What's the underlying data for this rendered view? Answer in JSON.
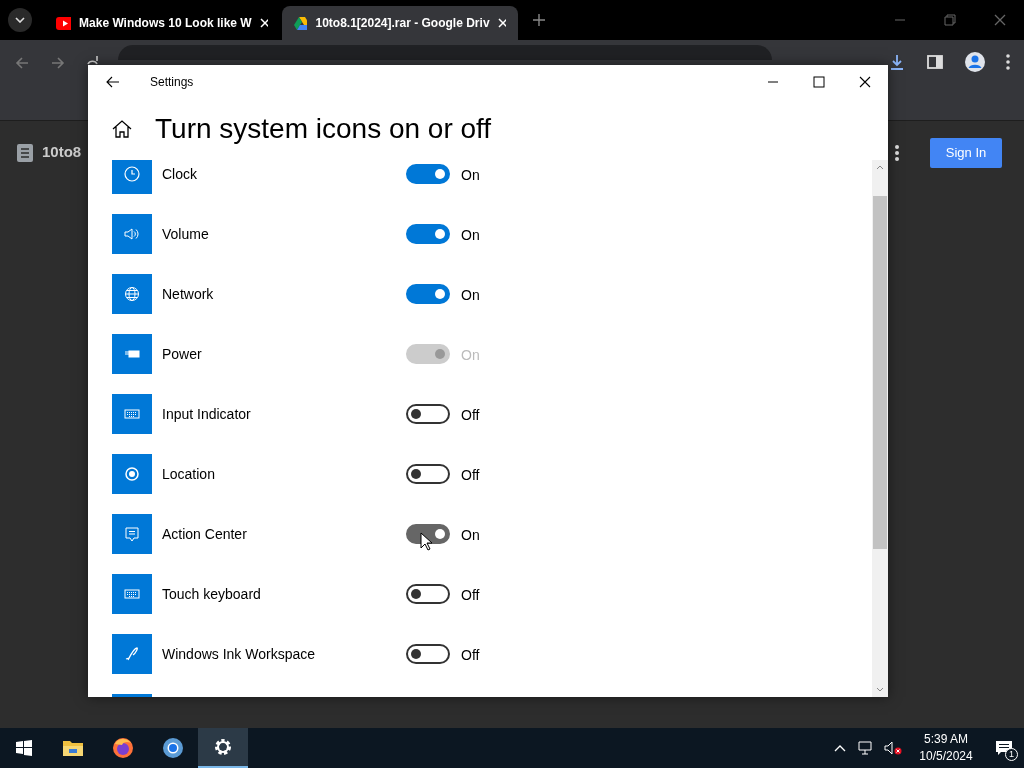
{
  "browser": {
    "tabs": [
      {
        "title": "Make Windows 10 Look like W",
        "selected": false
      },
      {
        "title": "10to8.1[2024].rar - Google Driv",
        "selected": true
      }
    ],
    "file_name": "10to8",
    "sign_in": "Sign In"
  },
  "window": {
    "title": "Settings"
  },
  "page_title": "Turn system icons on or off",
  "items": [
    {
      "label": "Clock",
      "on": true,
      "disabled": false,
      "hovered": false,
      "state_text": "On"
    },
    {
      "label": "Volume",
      "on": true,
      "disabled": false,
      "hovered": false,
      "state_text": "On"
    },
    {
      "label": "Network",
      "on": true,
      "disabled": false,
      "hovered": false,
      "state_text": "On"
    },
    {
      "label": "Power",
      "on": true,
      "disabled": true,
      "hovered": false,
      "state_text": "On"
    },
    {
      "label": "Input Indicator",
      "on": false,
      "disabled": false,
      "hovered": false,
      "state_text": "Off"
    },
    {
      "label": "Location",
      "on": false,
      "disabled": false,
      "hovered": false,
      "state_text": "Off"
    },
    {
      "label": "Action Center",
      "on": true,
      "disabled": false,
      "hovered": true,
      "state_text": "On"
    },
    {
      "label": "Touch keyboard",
      "on": false,
      "disabled": false,
      "hovered": false,
      "state_text": "Off"
    },
    {
      "label": "Windows Ink Workspace",
      "on": false,
      "disabled": false,
      "hovered": false,
      "state_text": "Off"
    }
  ],
  "taskbar": {
    "apps": [
      {
        "selected": false
      },
      {
        "selected": false
      },
      {
        "selected": false
      },
      {
        "selected": true
      }
    ],
    "time": "5:39 AM",
    "date": "10/5/2024",
    "notification_count": "1"
  }
}
